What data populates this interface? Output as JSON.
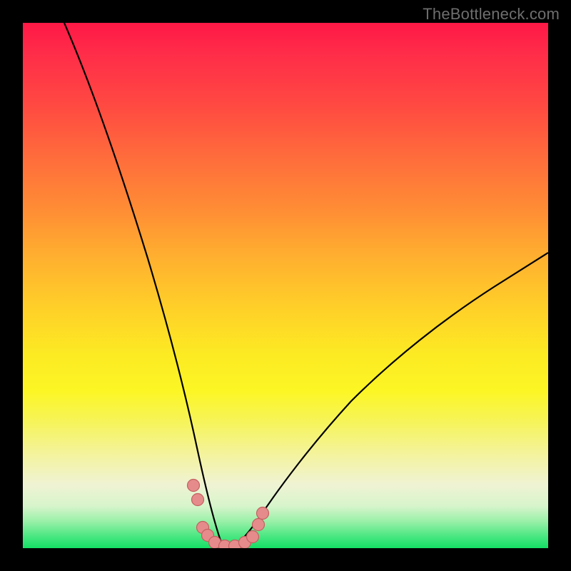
{
  "watermark": {
    "text": "TheBottleneck.com"
  },
  "chart_data": {
    "type": "line",
    "title": "",
    "xlabel": "",
    "ylabel": "",
    "xlim": [
      0,
      100
    ],
    "ylim": [
      0,
      100
    ],
    "grid": false,
    "colors": {
      "curve": "#000000",
      "markers_fill": "#e58b8b",
      "markers_stroke": "#c46060",
      "background_top": "#ff1846",
      "background_bottom": "#14e065"
    },
    "series": [
      {
        "name": "curve-left",
        "x": [
          8,
          12,
          16,
          20,
          24,
          28,
          31,
          33,
          35,
          36.5,
          38
        ],
        "y": [
          100,
          85,
          70,
          55,
          41,
          27,
          15,
          9,
          4,
          1.5,
          0
        ]
      },
      {
        "name": "curve-right",
        "x": [
          38,
          40,
          43,
          48,
          55,
          63,
          72,
          82,
          92,
          100
        ],
        "y": [
          0,
          1,
          4,
          10,
          18,
          27,
          35,
          43,
          50,
          56
        ]
      }
    ],
    "annotations": [
      {
        "name": "marker",
        "x": 32.5,
        "y": 12.0
      },
      {
        "name": "marker",
        "x": 33.3,
        "y": 9.2
      },
      {
        "name": "marker",
        "x": 34.2,
        "y": 3.9
      },
      {
        "name": "marker",
        "x": 35.2,
        "y": 2.4
      },
      {
        "name": "marker",
        "x": 36.6,
        "y": 1.1
      },
      {
        "name": "marker",
        "x": 38.4,
        "y": 0.4
      },
      {
        "name": "marker",
        "x": 40.3,
        "y": 0.4
      },
      {
        "name": "marker",
        "x": 42.2,
        "y": 1.1
      },
      {
        "name": "marker",
        "x": 43.8,
        "y": 2.2
      },
      {
        "name": "marker",
        "x": 44.8,
        "y": 4.5
      },
      {
        "name": "marker",
        "x": 45.6,
        "y": 6.7
      }
    ]
  }
}
